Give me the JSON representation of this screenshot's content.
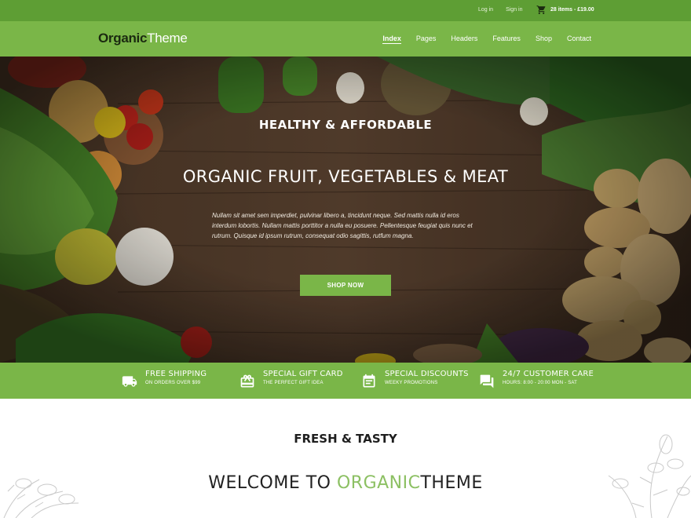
{
  "topbar": {
    "login": "Log in",
    "signin": "Sign in",
    "cart_text": "28 items - £19.00",
    "cart_icon": "cart-icon"
  },
  "brand": {
    "part1": "Organic",
    "part2": "Theme"
  },
  "nav": {
    "items": [
      "Index",
      "Pages",
      "Headers",
      "Features",
      "Shop",
      "Contact"
    ],
    "active": "Index"
  },
  "hero": {
    "tagline": "HEALTHY & AFFORDABLE",
    "title": "ORGANIC FRUIT, VEGETABLES & MEAT",
    "description": "Nullam sit amet sem imperdiet, pulvinar libero a, tincidunt neque. Sed mattis nulla id eros interdum lobortis. Nullam mattis porttitor a nulla eu posuere. Pellentesque feugiat quis nunc et rutrum. Quisque id ipsum rutrum, consequat odio sagittis, rutfum magna.",
    "button": "SHOP NOW"
  },
  "features": [
    {
      "icon": "truck-icon",
      "title": "FREE SHIPPING",
      "subtitle": "ON ORDERS OVER $99"
    },
    {
      "icon": "gift-card-icon",
      "title": "SPECIAL GIFT CARD",
      "subtitle": "THE PERFECT GIFT IDEA"
    },
    {
      "icon": "calendar-icon",
      "title": "SPECIAL DISCOUNTS",
      "subtitle": "WEEKY PROMOTIONS"
    },
    {
      "icon": "chat-icon",
      "title": "24/7 CUSTOMER CARE",
      "subtitle": "HOURS: 8:00 - 20:00 MON - SAT"
    }
  ],
  "welcome": {
    "kicker": "FRESH & TASTY",
    "title_pre": "WELCOME TO ",
    "title_accent": "ORGANIC",
    "title_post": "THEME"
  },
  "colors": {
    "topbar": "#5e9e34",
    "primary": "#7ab648",
    "accent_text": "#8cc063",
    "wood": "#3a2a1e"
  }
}
